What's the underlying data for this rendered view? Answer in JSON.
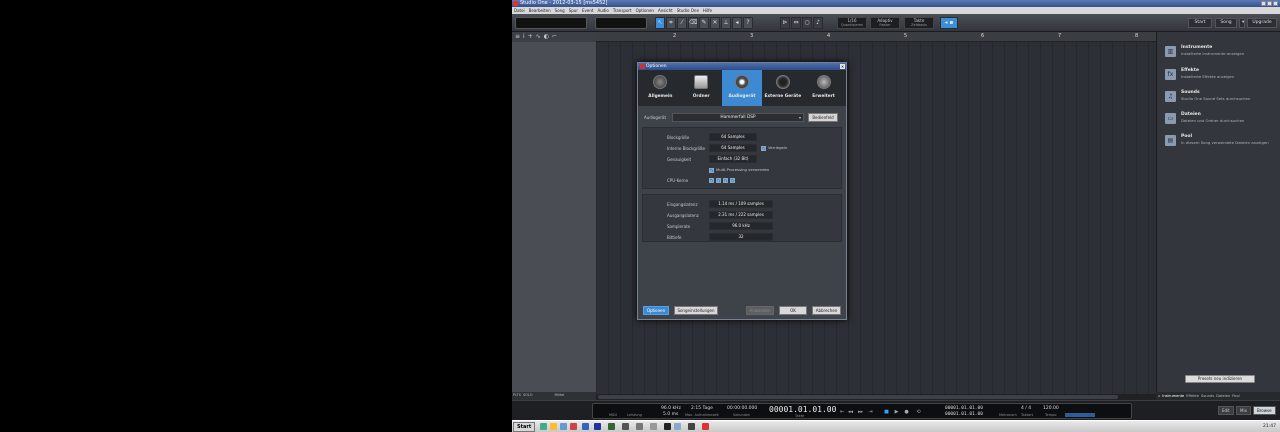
{
  "window": {
    "title": "Studio One - 2012-03-15 [ms5452]"
  },
  "menu": [
    "Datei",
    "Bearbeiten",
    "Song",
    "Spur",
    "Event",
    "Audio",
    "Transport",
    "Optionen",
    "Ansicht",
    "Studio One",
    "Hilfe"
  ],
  "toolbar": {
    "tools": [
      "arrow",
      "range",
      "split",
      "eraser",
      "paint",
      "mute",
      "bend",
      "listen",
      "help"
    ],
    "quantize_value": "1/16",
    "quantize_label": "Quantisieren",
    "snap_value": "Adaptiv",
    "snap_label": "Raster",
    "timebase_value": "Takte",
    "timebase_label": "Zeitbasis",
    "start_label": "Start",
    "song_label": "Song",
    "upgrade_label": "Upgrade"
  },
  "ruler_marks": [
    "2",
    "3",
    "4",
    "5",
    "6",
    "7",
    "8"
  ],
  "track_footer": [
    "PLTS",
    "SOLO",
    "Mittel"
  ],
  "browser": {
    "items": [
      {
        "title": "Instrumente",
        "desc": "Installierte Instrumente anzeigen",
        "icon": "piano-icon"
      },
      {
        "title": "Effekte",
        "desc": "Installierte Effekte anzeigen",
        "icon": "fx-icon"
      },
      {
        "title": "Sounds",
        "desc": "Studio One Sound Sets durchsuchen",
        "icon": "sounds-icon"
      },
      {
        "title": "Dateien",
        "desc": "Dateien und Ordner durchsuchen",
        "icon": "folder-icon"
      },
      {
        "title": "Pool",
        "desc": "In diesem Song verwendete Dateien anzeigen",
        "icon": "pool-icon"
      }
    ],
    "preset_button": "Presets neu indizieren",
    "tabs": [
      "Instrumente",
      "Effekte",
      "Sounds",
      "Dateien",
      "Pool"
    ]
  },
  "transport": {
    "midi_label": "MIDI",
    "perf_label": "Leistung",
    "sample_rate": "96.0 kHz",
    "latency": "5.0 ms",
    "record_days": "2:15 Tage",
    "record_label": "Max. Aufnahmezeit",
    "seconds": "00:00:00.000",
    "seconds_label": "Sekunden",
    "position": "00001.01.01.00",
    "position_label": "Takte",
    "loop_start": "00001.01.01.00",
    "loop_end": "00001.01.01.00",
    "signature": "4 / 4",
    "signature_label": "Taktart",
    "tempo": "120.00",
    "tempo_label": "Tempo",
    "metronome_label": "Metronom",
    "edit_label": "Edit",
    "mix_label": "Mix",
    "browse_label": "Browse"
  },
  "taskbar": {
    "start_label": "Start",
    "clock": "21:47"
  },
  "dialog": {
    "title": "Optionen",
    "tabs": [
      "Allgemein",
      "Ordner",
      "Audiogerät",
      "Externe Geräte",
      "Erweitert"
    ],
    "active_tab": "Audiogerät",
    "device_label": "Audiogerät",
    "device_value": "Hammerfall DSP",
    "control_panel": "Bedienfeld",
    "block_size_label": "Blockgröße",
    "block_size_value": "64 Samples",
    "internal_block_label": "Interne Blockgröße",
    "internal_block_value": "64 Samples",
    "lock_label": "Verriegeln",
    "precision_label": "Genauigkeit",
    "precision_value": "Einfach (32 Bit)",
    "multi_label": "Multi-Processing verwenden",
    "cpu_label": "CPU-Kerne",
    "input_latency_label": "Eingangslatenz",
    "input_latency_value": "1.14 ms / 109 samples",
    "output_latency_label": "Ausgangslatenz",
    "output_latency_value": "2.31 ms / 222 samples",
    "sample_rate_label": "Samplerate",
    "sample_rate_value": "96.0 kHz",
    "bit_depth_label": "Bittiefe",
    "bit_depth_value": "32",
    "footer": {
      "options": "Optionen",
      "song_settings": "Songeinstellungen",
      "apply": "Anwenden",
      "ok": "OK",
      "cancel": "Abbrechen"
    }
  }
}
